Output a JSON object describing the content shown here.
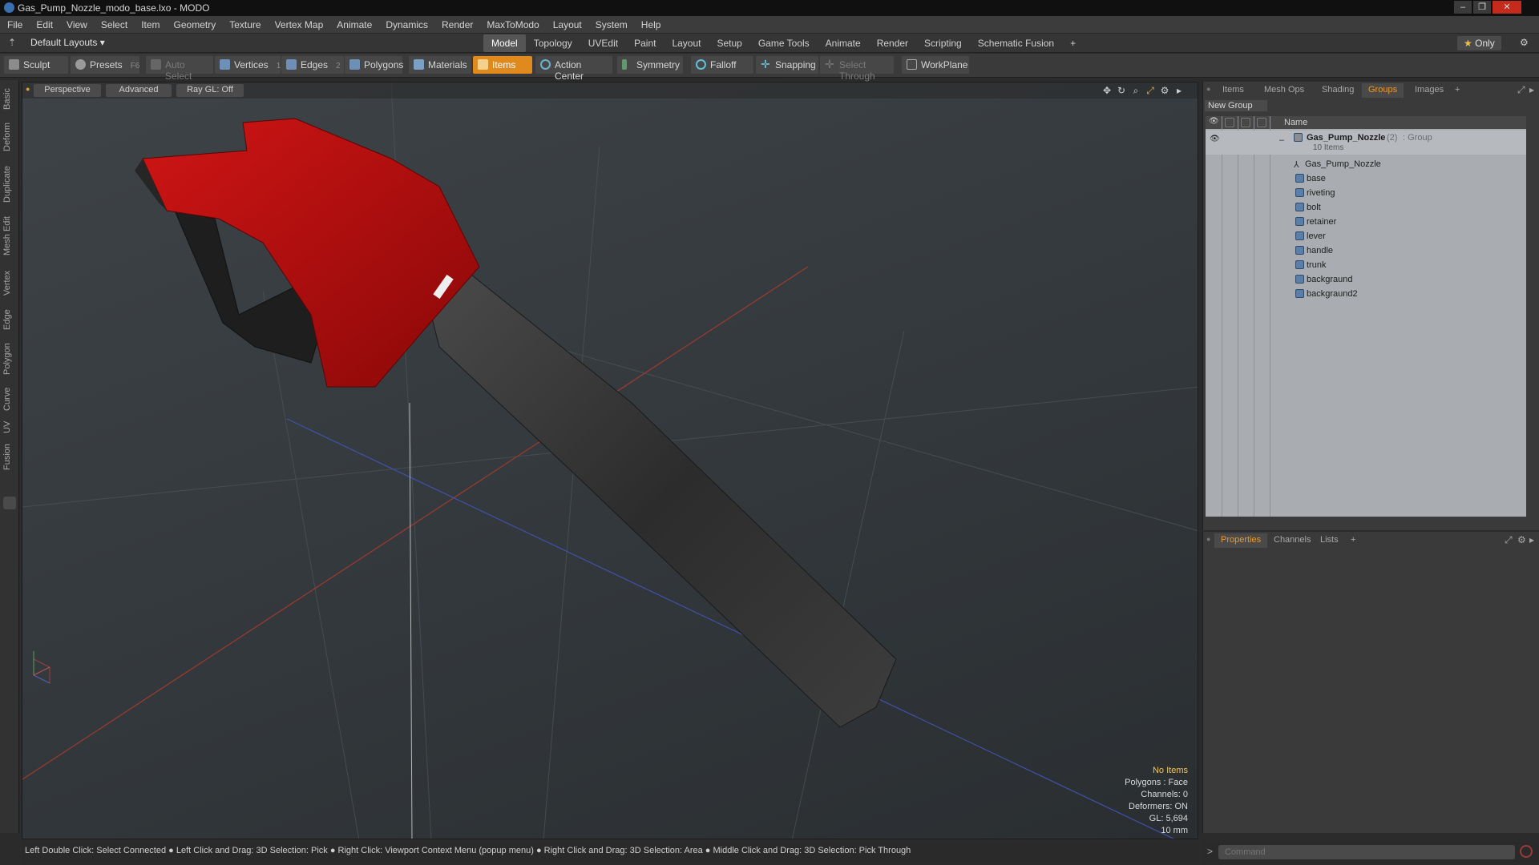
{
  "window": {
    "title": "Gas_Pump_Nozzle_modo_base.lxo - MODO"
  },
  "menus": [
    "File",
    "Edit",
    "View",
    "Select",
    "Item",
    "Geometry",
    "Texture",
    "Vertex Map",
    "Animate",
    "Dynamics",
    "Render",
    "MaxToModo",
    "Layout",
    "System",
    "Help"
  ],
  "layoutbar": {
    "layouts_dropdown": "Default Layouts",
    "tabs": [
      "Model",
      "Topology",
      "UVEdit",
      "Paint",
      "Layout",
      "Setup",
      "Game Tools",
      "Animate",
      "Render",
      "Scripting",
      "Schematic Fusion"
    ],
    "active_tab": "Model",
    "only_label": "Only"
  },
  "toolbar": {
    "sculpt": "Sculpt",
    "presets": "Presets",
    "presets_key": "F6",
    "auto_select": "Auto Select",
    "vertices": "Vertices",
    "vertices_key": "1",
    "edges": "Edges",
    "edges_key": "2",
    "polygons": "Polygons",
    "materials": "Materials",
    "items": "Items",
    "action_center": "Action Center",
    "symmetry": "Symmetry",
    "falloff": "Falloff",
    "snapping": "Snapping",
    "select_through": "Select Through",
    "workplane": "WorkPlane"
  },
  "left_tabs": [
    "Basic",
    "Deform",
    "Duplicate",
    "Mesh Edit",
    "Vertex",
    "Edge",
    "Polygon",
    "Curve",
    "UV",
    "Fusion"
  ],
  "viewport": {
    "view_mode": "Perspective",
    "shading": "Advanced",
    "raygl": "Ray GL: Off",
    "info": {
      "selection": "No Items",
      "polygons": "Polygons : Face",
      "channels": "Channels: 0",
      "deformers": "Deformers: ON",
      "gl": "GL: 5,694",
      "scale": "10 mm"
    }
  },
  "status_bar": "Left Double Click: Select Connected ● Left Click and Drag: 3D Selection: Pick ● Right Click: Viewport Context Menu (popup menu) ● Right Click and Drag: 3D Selection: Area ● Middle Click and Drag: 3D Selection: Pick Through",
  "groups_panel": {
    "tabs": [
      "Items",
      "Mesh Ops",
      "Shading",
      "Groups",
      "Images"
    ],
    "active_tab": "Groups",
    "new_group": "New Group",
    "column_name": "Name",
    "group": {
      "name": "Gas_Pump_Nozzle",
      "count": "(2)",
      "type": ": Group",
      "subtitle": "10 Items"
    },
    "items": [
      "Gas_Pump_Nozzle",
      "base",
      "riveting",
      "bolt",
      "retainer",
      "lever",
      "handle",
      "trunk",
      "backgraund",
      "backgraund2"
    ]
  },
  "properties_panel": {
    "tabs": [
      "Properties",
      "Channels",
      "Lists"
    ],
    "active_tab": "Properties"
  },
  "command": {
    "placeholder": "Command"
  },
  "colors": {
    "accent": "#e89a2c",
    "nozzle_red": "#b80d0d",
    "hose_dark": "#3a3a3a",
    "viewport_bg": "#373c40"
  }
}
